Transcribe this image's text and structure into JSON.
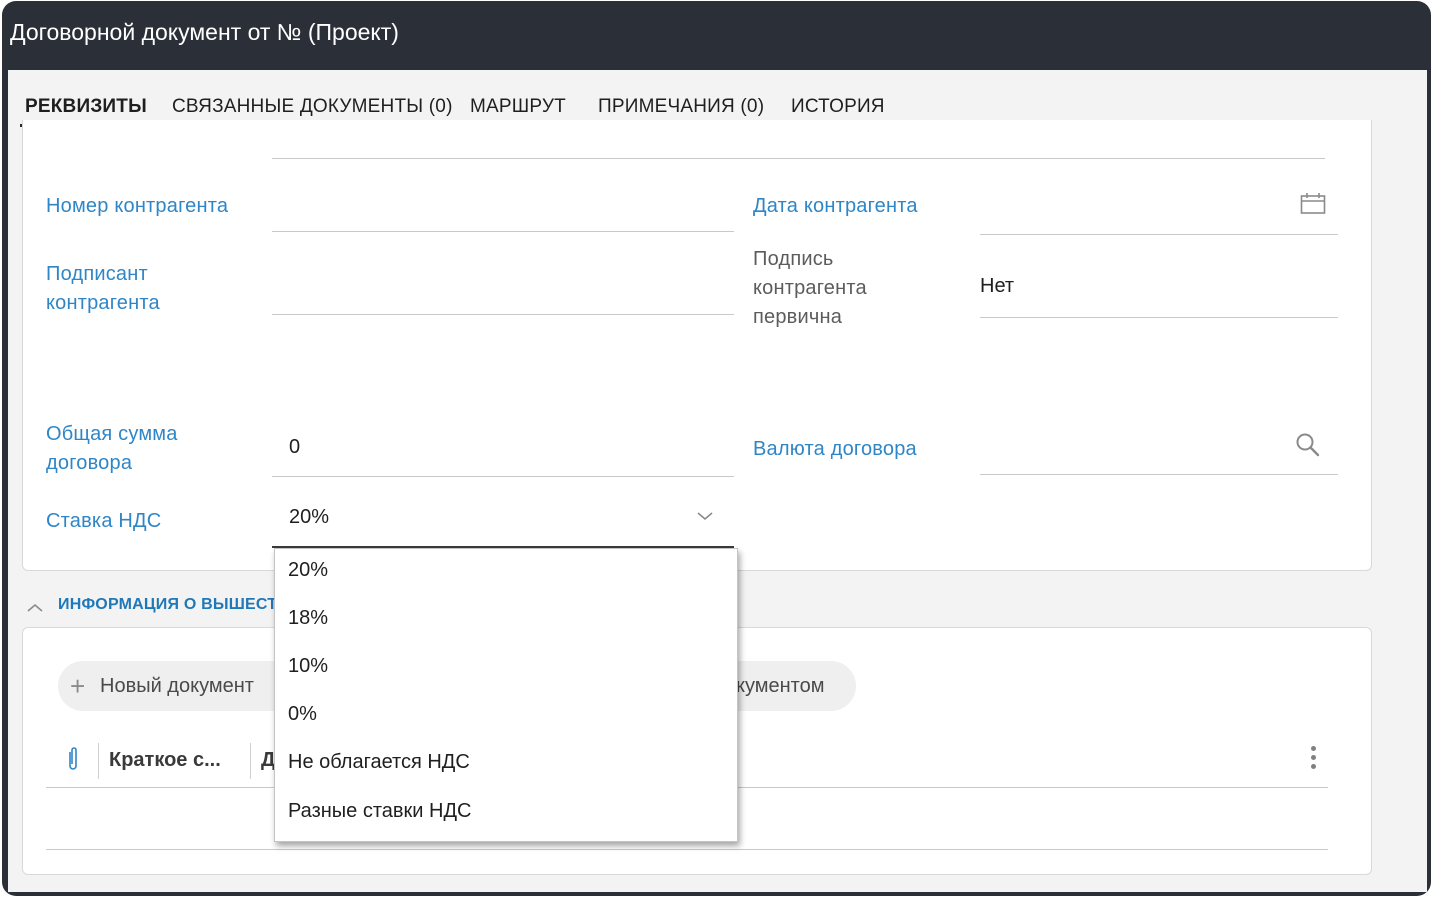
{
  "window": {
    "title": "Договорной документ от № (Проект)"
  },
  "tabs": [
    {
      "label": "РЕКВИЗИТЫ",
      "active": true
    },
    {
      "label": "СВЯЗАННЫЕ ДОКУМЕНТЫ (0)",
      "active": false
    },
    {
      "label": "МАРШРУТ",
      "active": false
    },
    {
      "label": "ПРИМЕЧАНИЯ (0)",
      "active": false
    },
    {
      "label": "ИСТОРИЯ",
      "active": false
    }
  ],
  "form": {
    "counterparty_number": {
      "label": "Номер контрагента",
      "value": ""
    },
    "counterparty_date": {
      "label": "Дата контрагента",
      "value": "",
      "icon": "calendar-icon"
    },
    "counterparty_signer": {
      "label_line1": "Подписант",
      "label_line2": "контрагента",
      "value": ""
    },
    "counterparty_signature_primary": {
      "label_line1": "Подпись",
      "label_line2": "контрагента",
      "label_line3": "первична",
      "value": "Нет"
    },
    "total_amount": {
      "label_line1": "Общая сумма",
      "label_line2": "договора",
      "value": "0"
    },
    "contract_currency": {
      "label": "Валюта договора",
      "value": "",
      "icon": "search-icon"
    },
    "vat_rate": {
      "label": "Ставка НДС",
      "value": "20%",
      "icon": "chevron-down-icon",
      "options": [
        "20%",
        "18%",
        "10%",
        "0%",
        "Не облагается НДС",
        "Разные ставки НДС"
      ]
    }
  },
  "section": {
    "title": "ИНФОРМАЦИЯ О ВЫШЕСТО",
    "new_document_button": "Новый документ",
    "second_button_fragment": "кументом",
    "table": {
      "col_short": "Краткое с...",
      "col_next": "Д"
    }
  },
  "colors": {
    "titlebar": "#2b3038",
    "label_blue": "#2f86c6",
    "section_blue": "#1f78b8",
    "tab_underline": "#1e2a36"
  }
}
